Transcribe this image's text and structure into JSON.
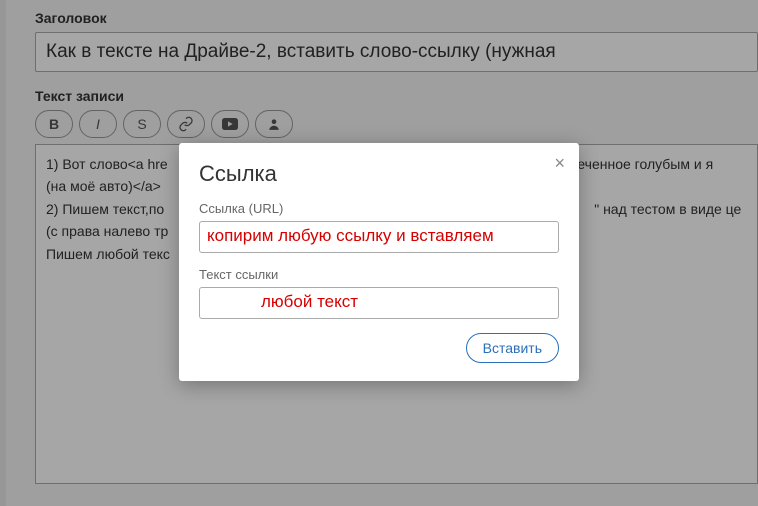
{
  "page": {
    "title_label": "Заголовок",
    "title_value": "Как в тексте на Драйве-2, вставить слово-ссылку (нужная ",
    "body_label": "Текст записи",
    "toolbar": {
      "bold": "B",
      "italic": "I",
      "strike": "S"
    },
    "body_lines": {
      "l1a": "1) Вот слово<a hre",
      "l1b": "меченное голубым и я",
      "l2": "(на моё авто)</a>",
      "l3a": " 2) Пишем текст,по",
      "l3b": "\" над тестом в виде це",
      "l4": "(с права налево тр",
      "l5": "Пишем любой текс"
    }
  },
  "modal": {
    "title": "Ссылка",
    "url_label": "Ссылка (URL)",
    "text_label": "Текст ссылки",
    "insert": "Вставить",
    "close": "×"
  },
  "annotations": {
    "url_note": "копирим любую ссылку и вставляем",
    "text_note": "любой текст"
  }
}
